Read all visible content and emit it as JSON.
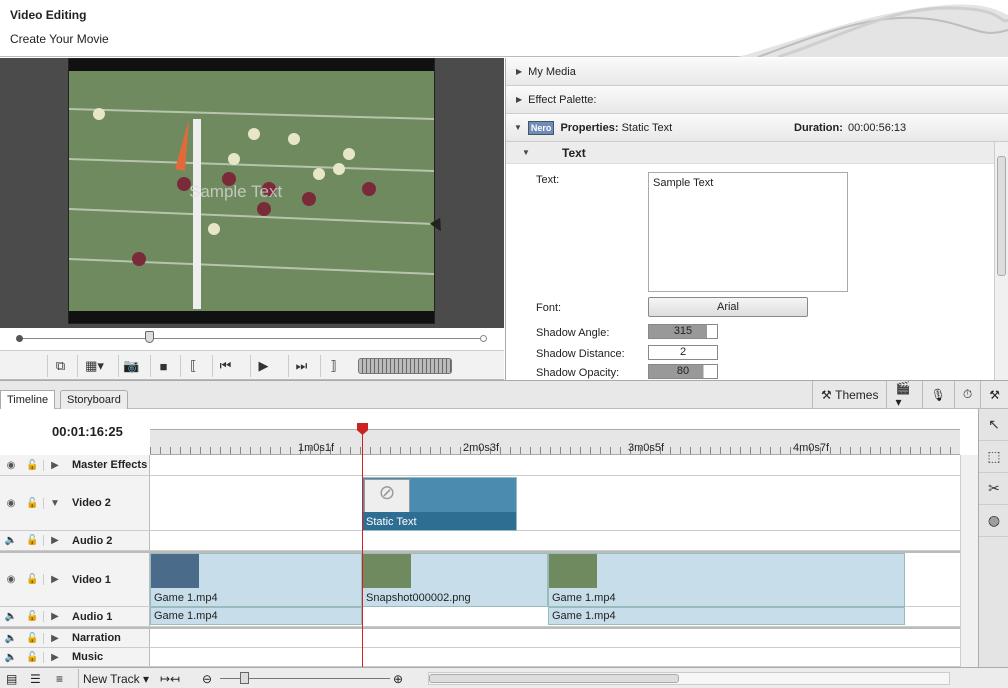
{
  "header": {
    "title": "Video Editing",
    "subtitle": "Create Your Movie"
  },
  "right": {
    "my_media": "My Media",
    "effect_palette": "Effect Palette:",
    "properties_label": "Properties:",
    "properties_value": "Static Text",
    "duration_label": "Duration:",
    "duration_value": "00:00:56:13",
    "nero_badge": "Nero",
    "section": "Text",
    "text_label": "Text:",
    "text_value": "Sample Text",
    "font_label": "Font:",
    "font_value": "Arial",
    "shadow_angle_label": "Shadow Angle:",
    "shadow_angle_value": "315",
    "shadow_distance_label": "Shadow Distance:",
    "shadow_distance_value": "2",
    "shadow_opacity_label": "Shadow Opacity:",
    "shadow_opacity_value": "80"
  },
  "preview": {
    "overlay_text": "Sample Text"
  },
  "tabs": {
    "timeline": "Timeline",
    "storyboard": "Storyboard",
    "themes": "Themes"
  },
  "timeline": {
    "timecode": "00:01:16:25",
    "ruler": [
      "1m0s1f",
      "2m0s3f",
      "3m0s5f",
      "4m0s7f"
    ],
    "tracks": [
      "Master Effects",
      "Video 2",
      "Audio 2",
      "Video 1",
      "Audio 1",
      "Narration",
      "Music"
    ],
    "clips": {
      "static_text": "Static Text",
      "v1a": "Game 1.mp4",
      "v1b": "Snapshot000002.png",
      "v1c": "Game 1.mp4",
      "a1a": "Game 1.mp4",
      "a1c": "Game 1.mp4"
    }
  },
  "bottom": {
    "new_track": "New Track"
  }
}
